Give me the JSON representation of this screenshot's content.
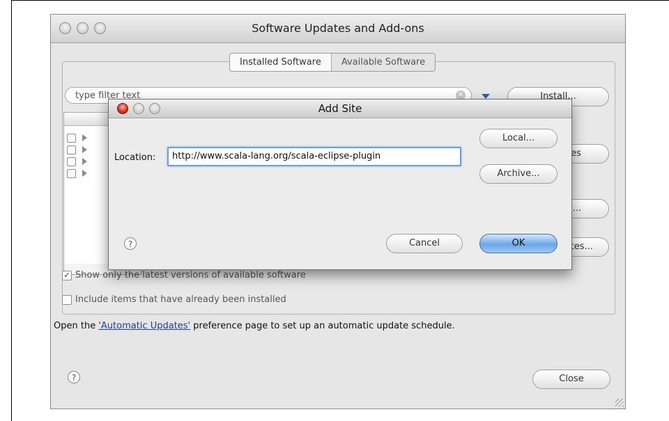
{
  "window": {
    "title": "Software Updates and Add-ons",
    "tabs": [
      {
        "label": "Installed Software",
        "active": false
      },
      {
        "label": "Available Software",
        "active": true
      }
    ],
    "filter": {
      "placeholder": "type filter text"
    },
    "side_buttons": [
      {
        "label": "Install..."
      },
      {
        "label": "Properties"
      },
      {
        "label": "Add Site..."
      },
      {
        "label": "Manage Sites..."
      }
    ],
    "options": [
      {
        "label": "Show only the latest versions of available software",
        "checked": true
      },
      {
        "label": "Include items that have already been installed",
        "checked": false
      }
    ],
    "auto_updates": {
      "prefix": "Open the ",
      "link": "'Automatic Updates'",
      "suffix": " preference page to set up an automatic update schedule."
    },
    "close_label": "Close",
    "help_icon": "question-mark-icon"
  },
  "dialog": {
    "title": "Add Site",
    "location_label": "Location:",
    "location_value": "http://www.scala-lang.org/scala-eclipse-plugin",
    "local_label": "Local...",
    "archive_label": "Archive...",
    "cancel_label": "Cancel",
    "ok_label": "OK",
    "help_icon": "question-mark-icon"
  },
  "colors": {
    "accent": "#6aa6e8",
    "link": "#1a3fa8",
    "close_light": "#d82c1a"
  }
}
